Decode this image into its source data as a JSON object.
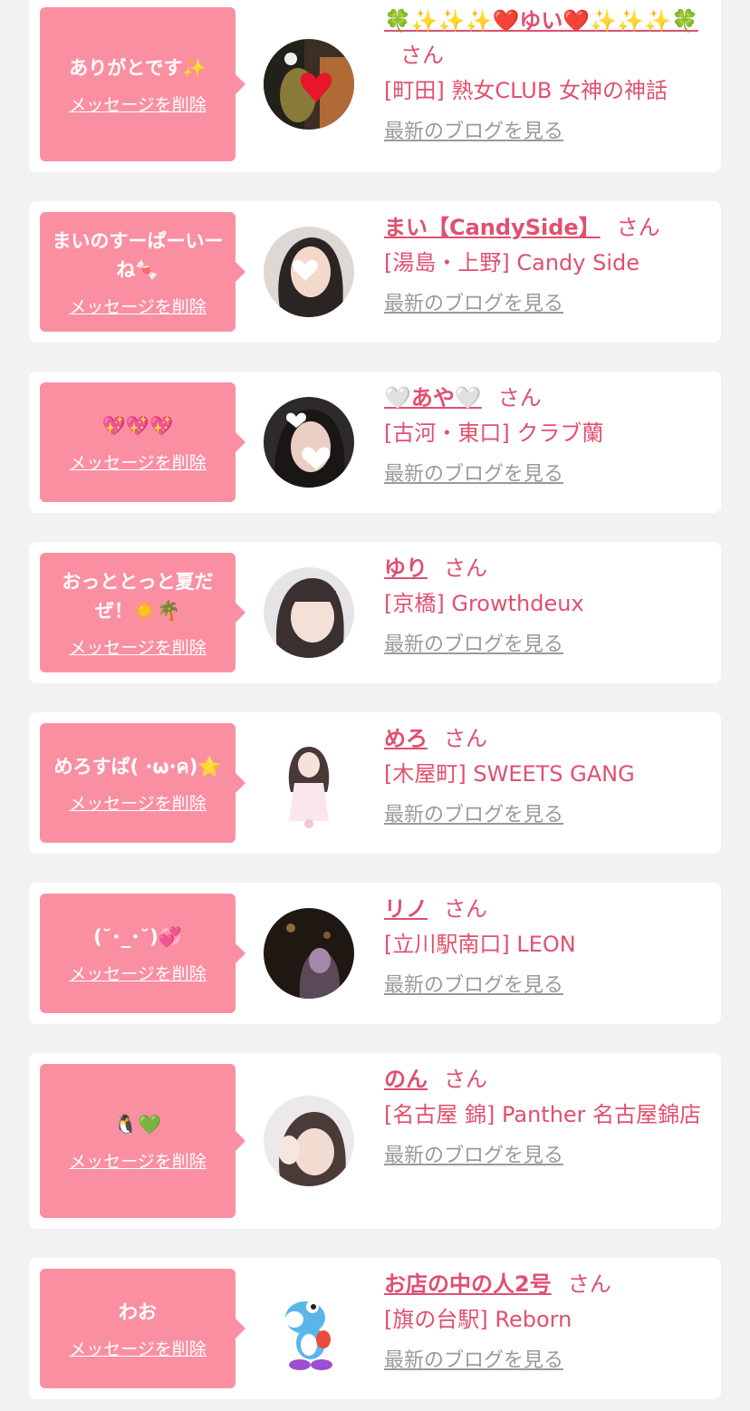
{
  "san": "さん",
  "delete_label": "メッセージを削除",
  "blog_label": "最新のブログを見る",
  "items": [
    {
      "message": "ありがとです✨",
      "name": "🍀✨✨✨❤️ゆい❤️✨✨✨🍀",
      "shop": "[町田] 熟女CLUB 女神の神話",
      "avatar_icon": "heart-sticker-photo"
    },
    {
      "message": "まいのすーぱーいーね🍬",
      "name": "まい【CandySide】",
      "shop": "[湯島・上野] Candy Side",
      "avatar_icon": "heart-sticker-photo"
    },
    {
      "message": "💖💖💖",
      "name": "🤍あや🤍",
      "shop": "[古河・東口] クラブ蘭",
      "avatar_icon": "heart-sticker-photo"
    },
    {
      "message": "おっととっと夏だぜ！☀️🌴",
      "name": "ゆり",
      "shop": "[京橋] Growthdeux",
      "avatar_icon": "portrait-photo"
    },
    {
      "message": "めろすぱ( ·ω·ค)⭐️",
      "name": "めろ",
      "shop": "[木屋町] SWEETS GANG",
      "avatar_icon": "full-body-photo"
    },
    {
      "message": "(˘･_･˘)💞",
      "name": "リノ",
      "shop": "[立川駅南口] LEON",
      "avatar_icon": "dark-portrait-photo"
    },
    {
      "message": "🐧💚",
      "name": "のん",
      "shop": "[名古屋 錦] Panther 名古屋錦店",
      "avatar_icon": "portrait-photo"
    },
    {
      "message": "わお",
      "name": "お店の中の人2号",
      "shop": "[旗の台駅] Reborn",
      "avatar_icon": "yoshi-figure"
    }
  ]
}
